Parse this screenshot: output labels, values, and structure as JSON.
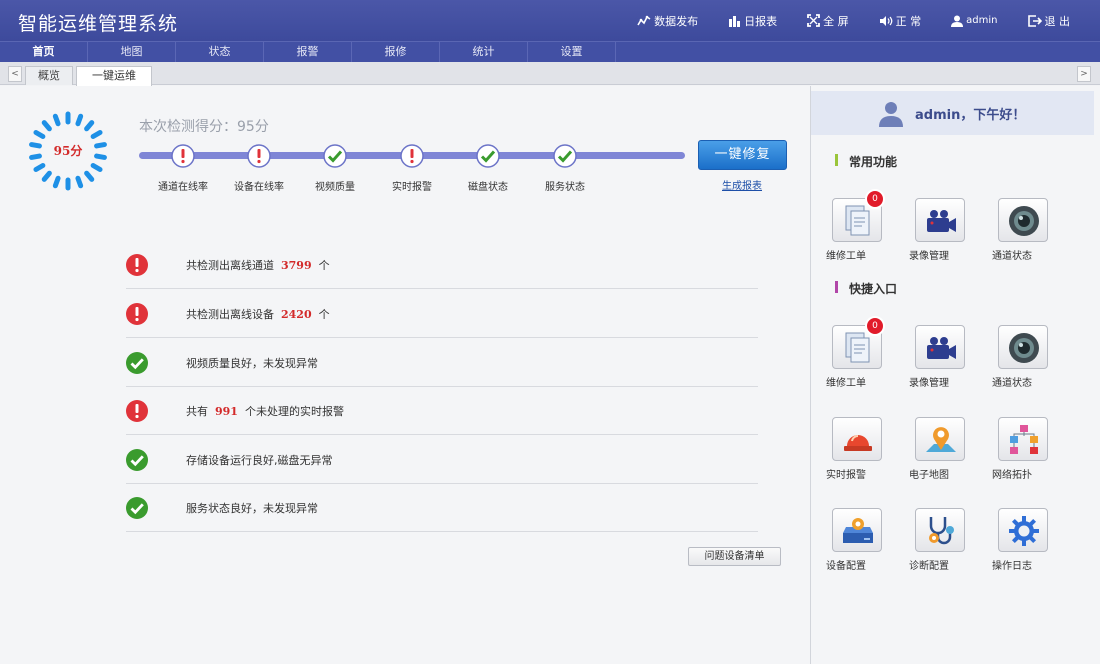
{
  "header": {
    "title": "智能运维管理系统",
    "actions": [
      {
        "label": "数据发布",
        "icon": "chart-line-icon"
      },
      {
        "label": "日报表",
        "icon": "bar-chart-icon"
      },
      {
        "label": "全 屏",
        "icon": "fullscreen-icon"
      },
      {
        "label": "正 常",
        "icon": "speaker-icon"
      },
      {
        "label": "admin",
        "icon": "user-icon"
      },
      {
        "label": "退 出",
        "icon": "logout-icon"
      }
    ]
  },
  "nav": {
    "items": [
      "首页",
      "地图",
      "状态",
      "报警",
      "报修",
      "统计",
      "设置"
    ],
    "active": "首页"
  },
  "tabs": {
    "items": [
      "概览",
      "一键运维"
    ],
    "active": "一键运维",
    "left_arrow": "<",
    "right_arrow": ">"
  },
  "score": {
    "value": "95分",
    "caption": "本次检测得分：95分"
  },
  "steps": [
    {
      "label": "通道在线率",
      "status": "error"
    },
    {
      "label": "设备在线率",
      "status": "error"
    },
    {
      "label": "视频质量",
      "status": "ok"
    },
    {
      "label": "实时报警",
      "status": "error"
    },
    {
      "label": "磁盘状态",
      "status": "ok"
    },
    {
      "label": "服务状态",
      "status": "ok"
    }
  ],
  "fix_button": "一键修复",
  "report_link": "生成报表",
  "results": [
    {
      "status": "error",
      "pre": "共检测出离线通道  ",
      "num": "3799",
      "post": "  个"
    },
    {
      "status": "error",
      "pre": "共检测出离线设备  ",
      "num": "2420",
      "post": "  个"
    },
    {
      "status": "ok",
      "pre": "视频质量良好，未发现异常",
      "num": "",
      "post": ""
    },
    {
      "status": "error",
      "pre": "共有  ",
      "num": "991",
      "post": "  个未处理的实时报警"
    },
    {
      "status": "ok",
      "pre": "存储设备运行良好,磁盘无异常",
      "num": "",
      "post": ""
    },
    {
      "status": "ok",
      "pre": "服务状态良好，未发现异常",
      "num": "",
      "post": ""
    }
  ],
  "list_button": "问题设备清单",
  "right_panel": {
    "greeting": "admin，下午好！",
    "common_title": "常用功能",
    "quick_title": "快捷入口",
    "common": [
      {
        "label": "维修工单",
        "icon": "document-icon",
        "badge": "0"
      },
      {
        "label": "录像管理",
        "icon": "video-camera-icon",
        "badge": ""
      },
      {
        "label": "通道状态",
        "icon": "camera-lens-icon",
        "badge": ""
      }
    ],
    "quick": [
      {
        "label": "维修工单",
        "icon": "document-icon",
        "badge": "0"
      },
      {
        "label": "录像管理",
        "icon": "video-camera-icon",
        "badge": ""
      },
      {
        "label": "通道状态",
        "icon": "camera-lens-icon",
        "badge": ""
      },
      {
        "label": "实时报警",
        "icon": "alarm-light-icon",
        "badge": ""
      },
      {
        "label": "电子地图",
        "icon": "map-pin-icon",
        "badge": ""
      },
      {
        "label": "网络拓扑",
        "icon": "network-topology-icon",
        "badge": ""
      },
      {
        "label": "设备配置",
        "icon": "device-config-icon",
        "badge": ""
      },
      {
        "label": "诊断配置",
        "icon": "stethoscope-icon",
        "badge": ""
      },
      {
        "label": "操作日志",
        "icon": "gear-icon",
        "badge": ""
      }
    ]
  },
  "colors": {
    "header": "#4250a4",
    "accent_red": "#e0333a",
    "accent_green": "#3a9b2e",
    "progress": "#7f86d6",
    "button_blue": "#1b6fc9"
  }
}
